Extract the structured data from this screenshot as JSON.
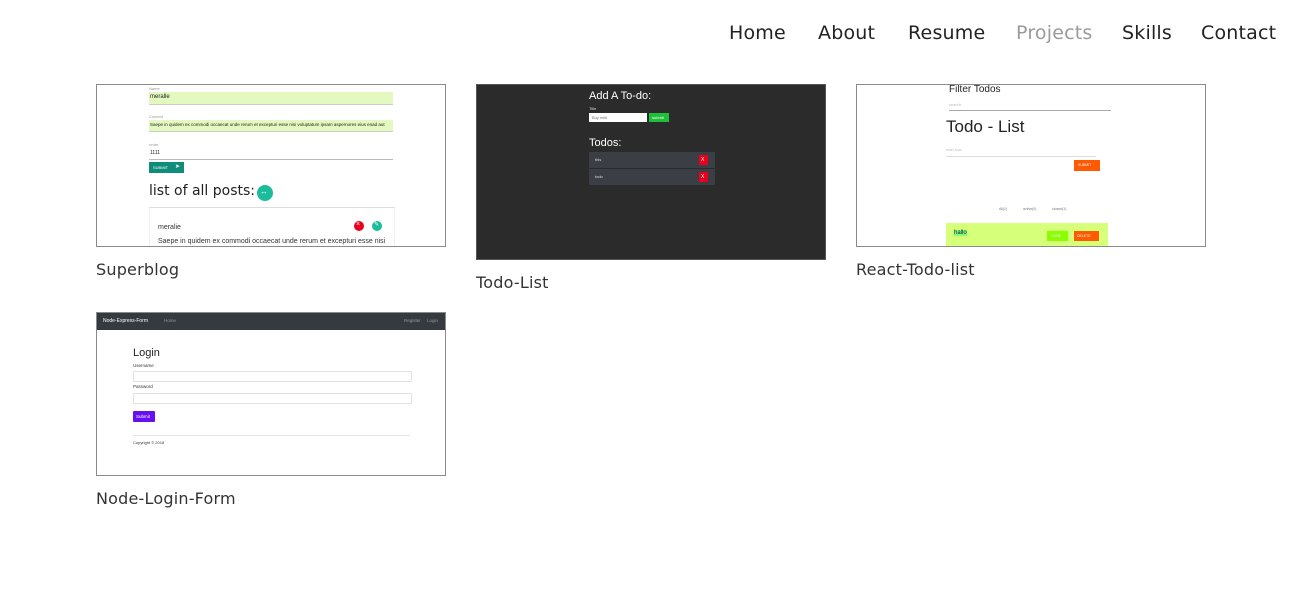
{
  "nav": {
    "items": [
      {
        "label": "Home",
        "active": false
      },
      {
        "label": "About",
        "active": false
      },
      {
        "label": "Resume",
        "active": false
      },
      {
        "label": "Projects",
        "active": true
      },
      {
        "label": "Skills",
        "active": false
      },
      {
        "label": "Contact",
        "active": false
      }
    ]
  },
  "projects": [
    {
      "title": "Superblog",
      "preview": {
        "name_label": "Name",
        "name_value": "meralle",
        "content_label": "Content",
        "content_value": "Saepe in quidem ex commodi occaecat unde rerum et excepturi esse nisi voluptatum ipsam aspernores eius enad aut",
        "order_label": "order",
        "order_value": "1111",
        "submit_label": "SUBMIT",
        "list_heading": "list of all posts:",
        "post_author": "meralie",
        "post_text": "Saepe in quidem ex commodi occaecat unde rerum et excepturi esse nisi"
      }
    },
    {
      "title": "Todo-List",
      "preview": {
        "heading": "Add A To-do:",
        "title_label": "Title",
        "input_value": "Buy milk",
        "submit_label": "submit",
        "todos_heading": "Todos:",
        "todos": [
          "this",
          "todo"
        ],
        "delete_label": "X"
      }
    },
    {
      "title": "React-Todo-list",
      "preview": {
        "filter_heading": "Filter Todos",
        "search_placeholder": "search",
        "heading": "Todo - List",
        "input_placeholder": "enter todo",
        "submit_label": "SUBMIT",
        "filters": [
          "All(1)",
          "active(0)",
          "closed(1)"
        ],
        "item": "hallo",
        "done_label": "DONE",
        "delete_label": "DELETE"
      }
    },
    {
      "title": "Node-Login-Form",
      "preview": {
        "brand": "Node-Express-Form",
        "home_link": "Home",
        "register_link": "Register",
        "login_link": "Login",
        "heading": "Login",
        "username_label": "Username",
        "password_label": "Password",
        "submit_label": "Submit",
        "copyright": "Copyright © 2018"
      }
    }
  ],
  "colors": {
    "nav_active": "#9a9a9a",
    "highlight_green": "#e4f9c0",
    "teal": "#0f8c7a",
    "todo_bg": "#2b2b2b",
    "todo_item": "#3b3f45",
    "react_orange": "#ff5a00",
    "react_green": "#d6ff7a",
    "login_bar": "#343a40",
    "login_button": "#6610f2"
  }
}
